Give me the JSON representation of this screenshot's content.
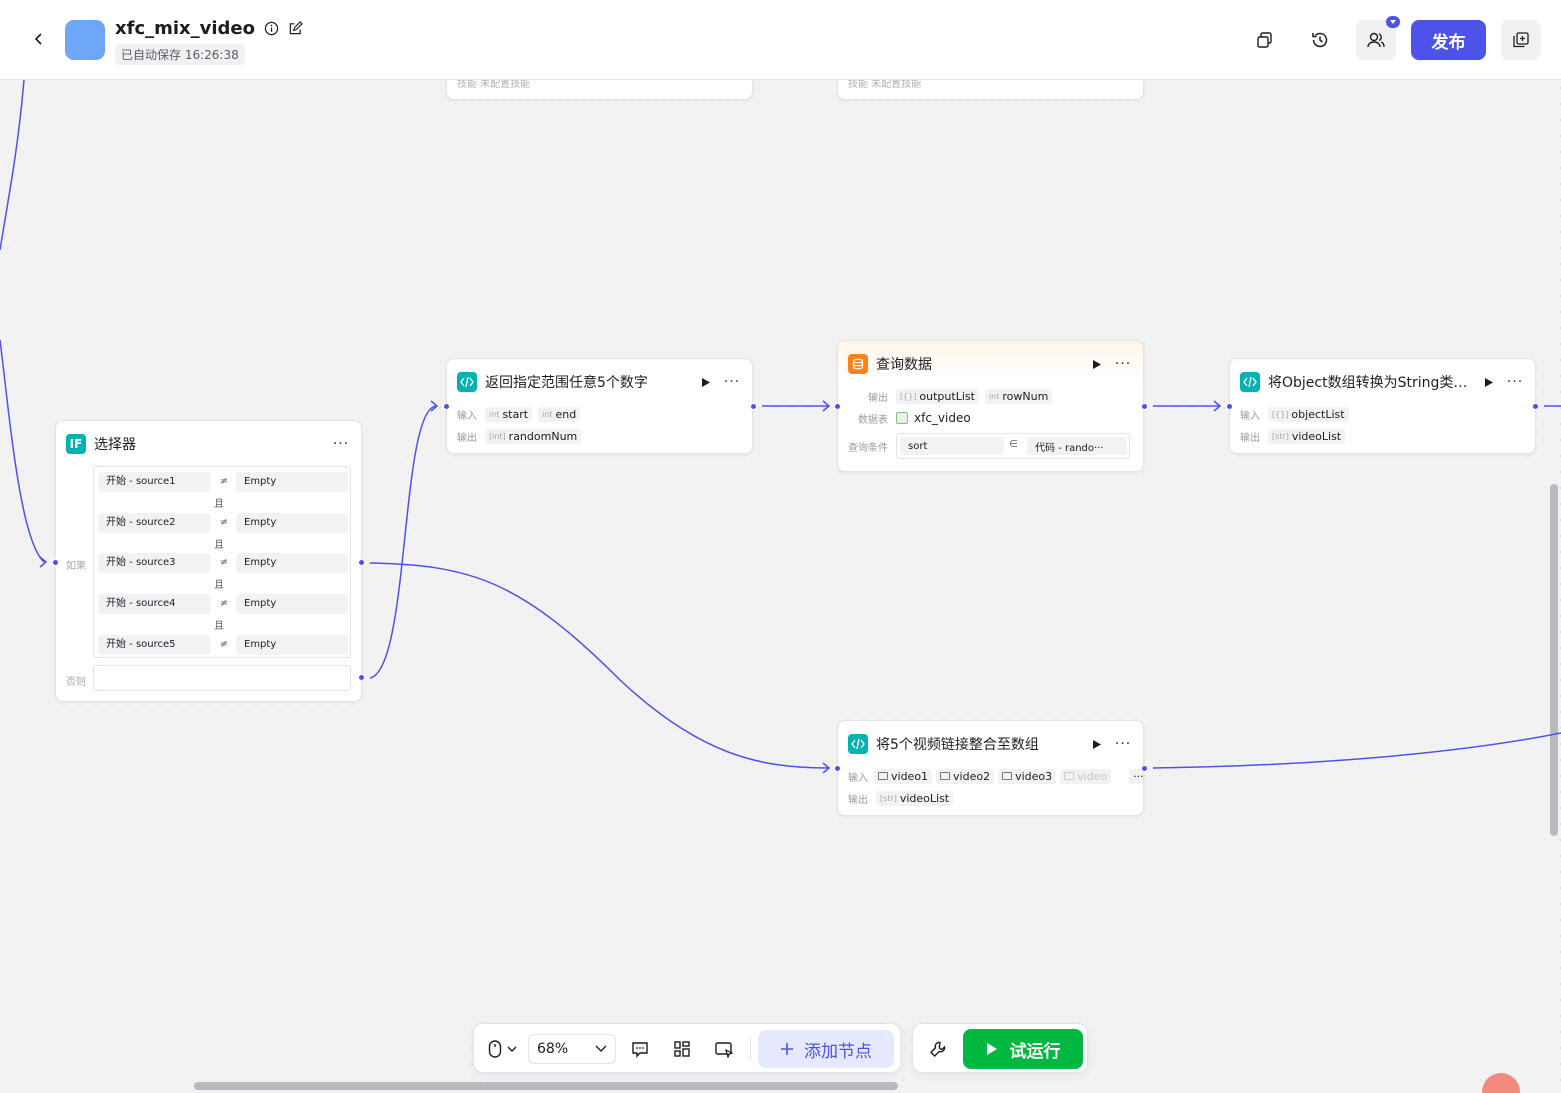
{
  "header": {
    "title": "xfc_mix_video",
    "autosave": "已自动保存 16:26:38",
    "publish_label": "发布",
    "icons": [
      "back-icon",
      "info-icon",
      "edit-icon",
      "duplicate-icon",
      "history-icon",
      "collaborators-icon",
      "copy-panel-icon"
    ],
    "accent": "#4d53e8"
  },
  "top_nodes": {
    "left_text": "技能  未配置技能",
    "right_text": "技能  未配置技能"
  },
  "selector": {
    "title": "选择器",
    "if_label": "如果",
    "else_label": "否则",
    "and_label": "且",
    "conditions": [
      {
        "left": "开始 - source1",
        "op": "≠",
        "right": "Empty"
      },
      {
        "left": "开始 - source2",
        "op": "≠",
        "right": "Empty"
      },
      {
        "left": "开始 - source3",
        "op": "≠",
        "right": "Empty"
      },
      {
        "left": "开始 - source4",
        "op": "≠",
        "right": "Empty"
      },
      {
        "left": "开始 - source5",
        "op": "≠",
        "right": "Empty"
      }
    ]
  },
  "node_random": {
    "title": "返回指定范围任意5个数字",
    "input_label": "输入",
    "output_label": "输出",
    "inputs": [
      {
        "type": "int",
        "name": "start"
      },
      {
        "type": "int",
        "name": "end"
      }
    ],
    "outputs": [
      {
        "type": "[int]",
        "name": "randomNum"
      }
    ]
  },
  "node_query": {
    "title": "查询数据",
    "output_label": "输出",
    "table_label": "数据表",
    "cond_label": "查询条件",
    "outputs": [
      {
        "type": "[{}]",
        "name": "outputList"
      },
      {
        "type": "int",
        "name": "rowNum"
      }
    ],
    "table": "xfc_video",
    "cond_field": "sort",
    "cond_op": "∈",
    "cond_value": "代码 - rando···"
  },
  "node_convert": {
    "title": "将Object数组转换为String类型···",
    "input_label": "输入",
    "output_label": "输出",
    "inputs": [
      {
        "type": "[{}]",
        "name": "objectList"
      }
    ],
    "outputs": [
      {
        "type": "[str]",
        "name": "videoList"
      }
    ]
  },
  "node_merge": {
    "title": "将5个视频链接整合至数组",
    "input_label": "输入",
    "output_label": "输出",
    "inputs": [
      "video1",
      "video2",
      "video3",
      "video"
    ],
    "more": "···",
    "outputs": [
      {
        "type": "[str]",
        "name": "videoList"
      }
    ]
  },
  "toolbar": {
    "zoom": "68%",
    "add_node": "添加节点",
    "run": "试运行"
  }
}
